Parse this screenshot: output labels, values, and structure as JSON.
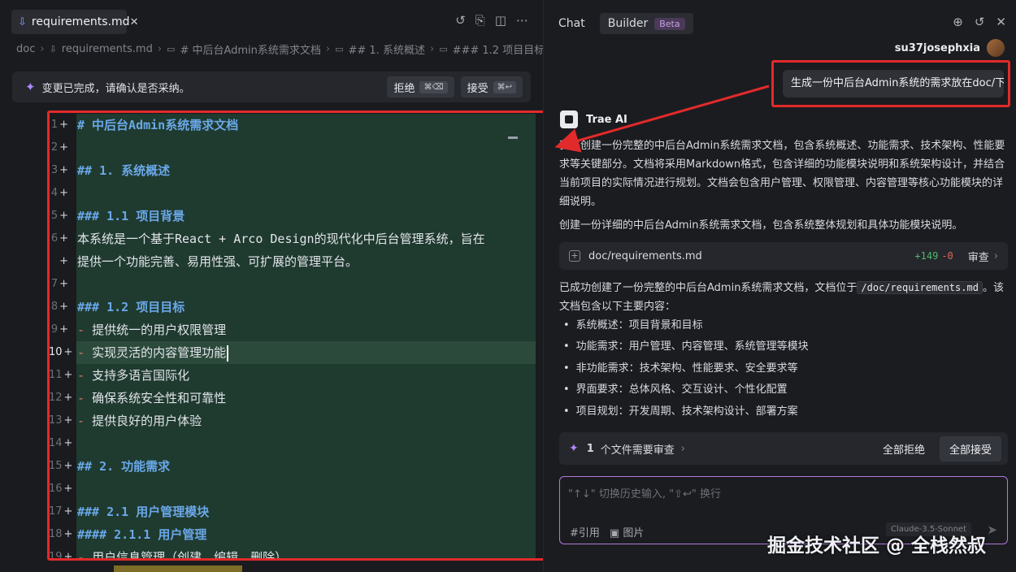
{
  "editor_tab": {
    "filename": "requirements.md",
    "file_icon": "download-arrow-icon"
  },
  "breadcrumb": [
    "doc",
    "requirements.md",
    "# 中后台Admin系统需求文档",
    "## 1. 系统概述",
    "### 1.2 项目目标"
  ],
  "notice": {
    "text": "变更已完成，请确认是否采纳。",
    "reject_label": "拒绝",
    "reject_key": "⌘⌫",
    "accept_label": "接受",
    "accept_key": "⌘↩"
  },
  "code": {
    "active_line": "10",
    "lines": [
      {
        "n": "1",
        "text": "# 中后台Admin系统需求文档",
        "kind": "h"
      },
      {
        "n": "2",
        "text": "",
        "kind": "t"
      },
      {
        "n": "3",
        "text": "## 1. 系统概述",
        "kind": "h"
      },
      {
        "n": "4",
        "text": "",
        "kind": "t"
      },
      {
        "n": "5",
        "text": "### 1.1 项目背景",
        "kind": "h"
      },
      {
        "n": "6",
        "text": "本系统是一个基于React + Arco Design的现代化中后台管理系统，旨在",
        "kind": "t"
      },
      {
        "n": "",
        "text": "提供一个功能完善、易用性强、可扩展的管理平台。",
        "kind": "t"
      },
      {
        "n": "7",
        "text": "",
        "kind": "t"
      },
      {
        "n": "8",
        "text": "### 1.2 项目目标",
        "kind": "h"
      },
      {
        "n": "9",
        "text": "提供统一的用户权限管理",
        "kind": "li"
      },
      {
        "n": "10",
        "text": "实现灵活的内容管理功能",
        "kind": "li"
      },
      {
        "n": "11",
        "text": "支持多语言国际化",
        "kind": "li"
      },
      {
        "n": "12",
        "text": "确保系统安全性和可靠性",
        "kind": "li"
      },
      {
        "n": "13",
        "text": "提供良好的用户体验",
        "kind": "li"
      },
      {
        "n": "14",
        "text": "",
        "kind": "t"
      },
      {
        "n": "15",
        "text": "## 2. 功能需求",
        "kind": "h"
      },
      {
        "n": "16",
        "text": "",
        "kind": "t"
      },
      {
        "n": "17",
        "text": "### 2.1 用户管理模块",
        "kind": "h"
      },
      {
        "n": "18",
        "text": "#### 2.1.1 用户管理",
        "kind": "h"
      },
      {
        "n": "19",
        "text": "用户信息管理（创建、编辑、删除）",
        "kind": "li"
      }
    ]
  },
  "panel": {
    "tab_chat": "Chat",
    "tab_builder": "Builder",
    "beta": "Beta",
    "username": "su37josephxia",
    "user_prompt": "生成一份中后台Admin系统的需求放在doc/下",
    "ai_name": "Trae AI",
    "ai_para1": "我将创建一份完整的中后台Admin系统需求文档，包含系统概述、功能需求、技术架构、性能要求等关键部分。文档将采用Markdown格式，包含详细的功能模块说明和系统架构设计，并结合当前项目的实际情况进行规划。文档会包含用户管理、权限管理、内容管理等核心功能模块的详细说明。",
    "ai_para2": "创建一份详细的中后台Admin系统需求文档，包含系统整体规划和具体功能模块说明。",
    "file_card": {
      "path": "doc/requirements.md",
      "added": "+149",
      "removed": "-0",
      "review": "审查"
    },
    "ai_para3_pre": "已成功创建了一份完整的中后台Admin系统需求文档，文档位于",
    "ai_para3_code": "/doc/requirements.md",
    "ai_para3_post": "。该文档包含以下主要内容：",
    "bullets": [
      "系统概述：项目背景和目标",
      "功能需求：用户管理、内容管理、系统管理等模块",
      "非功能需求：技术架构、性能要求、安全要求等",
      "界面要求：总体风格、交互设计、个性化配置",
      "项目规划：开发周期、技术架构设计、部署方案"
    ],
    "review_bar": {
      "count": "1",
      "label": "个文件需要审查",
      "reject_all": "全部拒绝",
      "accept_all": "全部接受"
    },
    "input": {
      "placeholder": "\"↑↓\" 切换历史输入, \"⇧↩\" 换行",
      "cite": "引用",
      "image": "图片",
      "model": "Claude-3.5-Sonnet"
    }
  },
  "watermark": "掘金技术社区 @ 全栈然叔",
  "colors": {
    "highlight_red": "#e32a2a",
    "diff_green_bg": "#1f3a2f",
    "heading_blue": "#6aa8e8",
    "accent_purple": "#b088ff"
  }
}
